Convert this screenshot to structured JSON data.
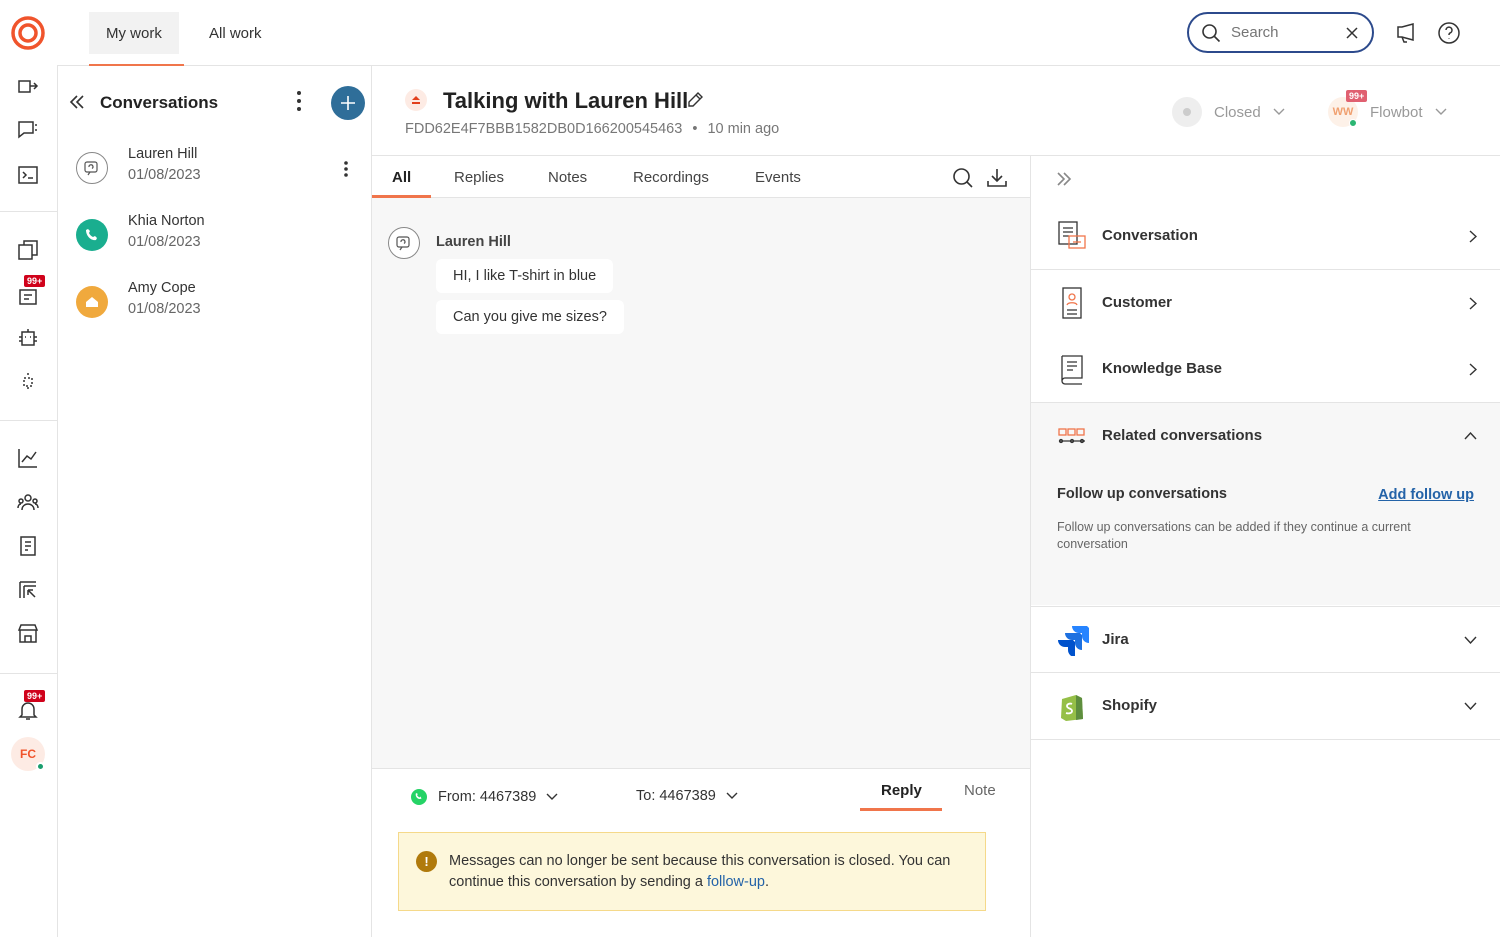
{
  "topbar": {
    "tabs": [
      {
        "label": "My work"
      },
      {
        "label": "All work"
      }
    ],
    "search_placeholder": "Search"
  },
  "rail": {
    "badge_queue": "99+",
    "badge_notifications": "99+",
    "user_initials": "FC"
  },
  "conversations_panel": {
    "title": "Conversations",
    "items": [
      {
        "name": "Lauren Hill",
        "date": "01/08/2023",
        "channel": "chat",
        "color": "#999999"
      },
      {
        "name": "Khia Norton",
        "date": "01/08/2023",
        "channel": "phone",
        "color": "#1aae8f"
      },
      {
        "name": "Amy Cope",
        "date": "01/08/2023",
        "channel": "web",
        "color": "#f0a93d"
      }
    ]
  },
  "conversation": {
    "title": "Talking with Lauren Hill",
    "id": "FDD62E4F7BBB1582DB0D166200545463",
    "separator": "•",
    "time_ago": "10 min ago",
    "status": "Closed",
    "agent_initials": "WW",
    "agent_badge": "99+",
    "agent_name": "Flowbot",
    "tabs": [
      "All",
      "Replies",
      "Notes",
      "Recordings",
      "Events"
    ],
    "messages": {
      "author": "Lauren Hill",
      "lines": [
        "HI, I like T-shirt in blue",
        "Can you give me sizes?"
      ]
    },
    "composer": {
      "from": "From: 4467389",
      "to": "To: 4467389",
      "tab_reply": "Reply",
      "tab_note": "Note",
      "alert_text": "Messages can no longer be sent because this conversation is closed. You can continue this conversation by sending a ",
      "alert_link": "follow-up",
      "alert_end": "."
    }
  },
  "right_panel": {
    "sections": [
      {
        "label": "Conversation"
      },
      {
        "label": "Customer"
      },
      {
        "label": "Knowledge Base"
      },
      {
        "label": "Related conversations"
      }
    ],
    "followup_title": "Follow up conversations",
    "followup_action": "Add follow up",
    "followup_desc": "Follow up conversations can be added if they continue a current conversation",
    "integrations": [
      {
        "label": "Jira"
      },
      {
        "label": "Shopify"
      }
    ]
  },
  "colors": {
    "accent": "#f0754b",
    "primary": "#2f6e99",
    "link": "#2463a8",
    "alert_bg": "#fdf7db"
  }
}
